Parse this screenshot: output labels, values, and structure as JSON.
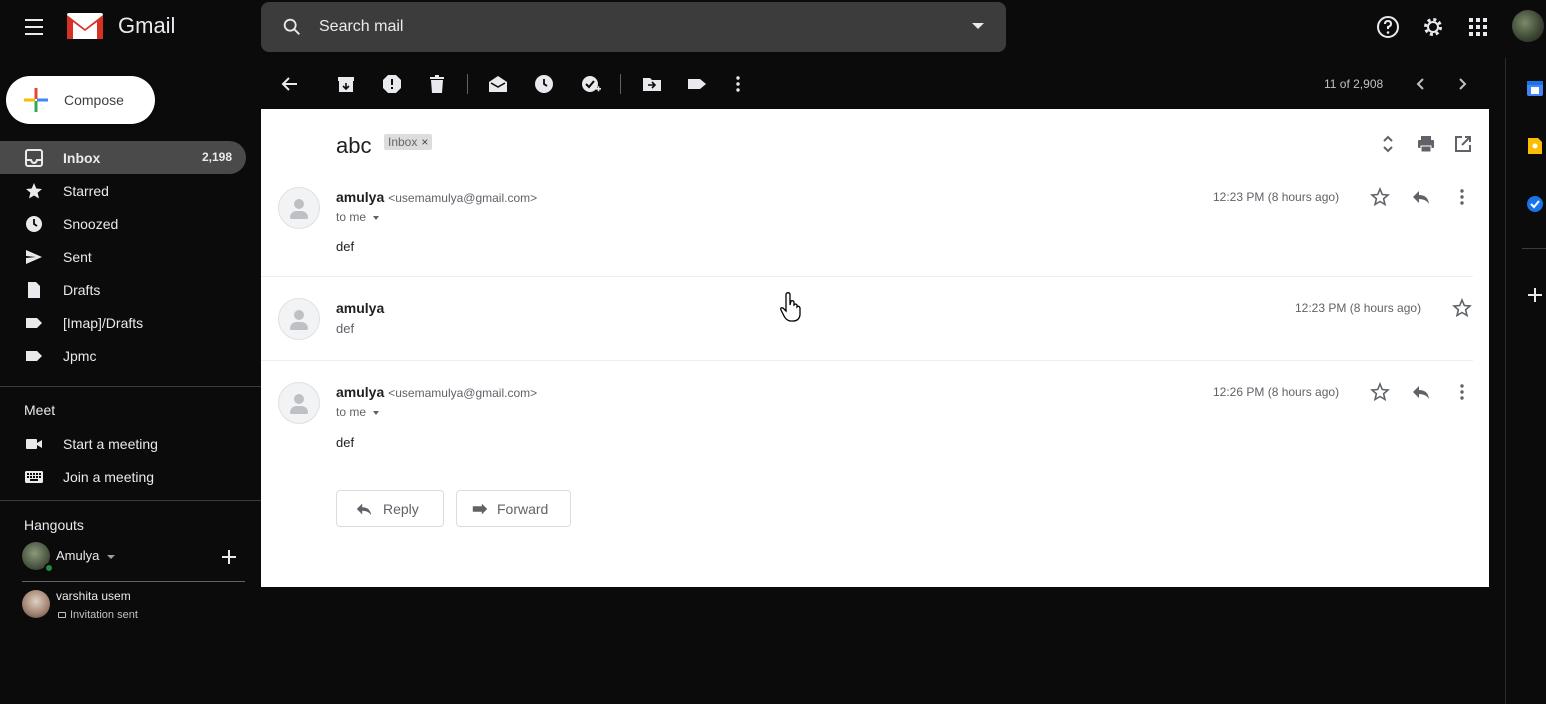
{
  "app": {
    "name": "Gmail"
  },
  "search": {
    "placeholder": "Search mail"
  },
  "compose": {
    "label": "Compose"
  },
  "nav": {
    "items": [
      {
        "label": "Inbox",
        "count": "2,198"
      },
      {
        "label": "Starred"
      },
      {
        "label": "Snoozed"
      },
      {
        "label": "Sent"
      },
      {
        "label": "Drafts"
      },
      {
        "label": "[Imap]/Drafts"
      },
      {
        "label": "Jpmc"
      }
    ]
  },
  "meet": {
    "title": "Meet",
    "start": "Start a meeting",
    "join": "Join a meeting"
  },
  "hangouts": {
    "title": "Hangouts",
    "user": "Amulya",
    "contact": {
      "name": "varshita usem",
      "status": "Invitation sent"
    }
  },
  "pager": {
    "text": "11 of 2,908"
  },
  "thread": {
    "subject": "abc",
    "label": "Inbox",
    "messages": [
      {
        "sender": "amulya",
        "email": "<usemamulya@gmail.com>",
        "to": "to me",
        "body": "def",
        "time": "12:23 PM (8 hours ago)"
      },
      {
        "sender": "amulya",
        "body": "def",
        "time": "12:23 PM (8 hours ago)"
      },
      {
        "sender": "amulya",
        "email": "<usemamulya@gmail.com>",
        "to": "to me",
        "body": "def",
        "time": "12:26 PM (8 hours ago)"
      }
    ],
    "reply_label": "Reply",
    "forward_label": "Forward"
  },
  "colors": {
    "background": "#0b0b0b",
    "active_nav": "#4a4a4a",
    "search_bg": "#3c3c3c",
    "online": "#1e8e3e"
  }
}
